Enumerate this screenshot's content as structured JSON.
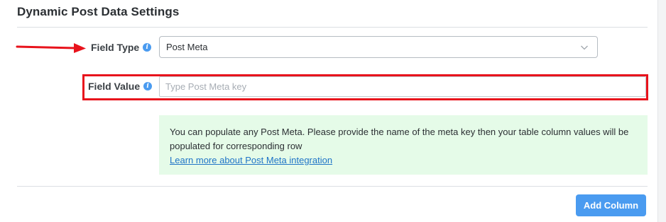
{
  "section": {
    "title": "Dynamic Post Data Settings"
  },
  "field_type": {
    "label": "Field Type",
    "selected_value": "Post Meta",
    "info_icon": "info-icon"
  },
  "field_value": {
    "label": "Field Value",
    "placeholder": "Type Post Meta key",
    "value": "",
    "info_icon": "info-icon"
  },
  "notice": {
    "text": "You can populate any Post Meta. Please provide the name of the meta key then your table column values will be populated for corresponding row",
    "link_text": "Learn more about Post Meta integration"
  },
  "actions": {
    "add_column_label": "Add Column"
  },
  "colors": {
    "accent": "#4a9bf0",
    "annotation_red": "#e8131c",
    "notice_bg": "#e5fbe8",
    "link": "#1f74c7"
  },
  "annotations": {
    "arrow": "red-arrow-pointing-right",
    "highlight": "red-rectangle-around-field-value"
  }
}
